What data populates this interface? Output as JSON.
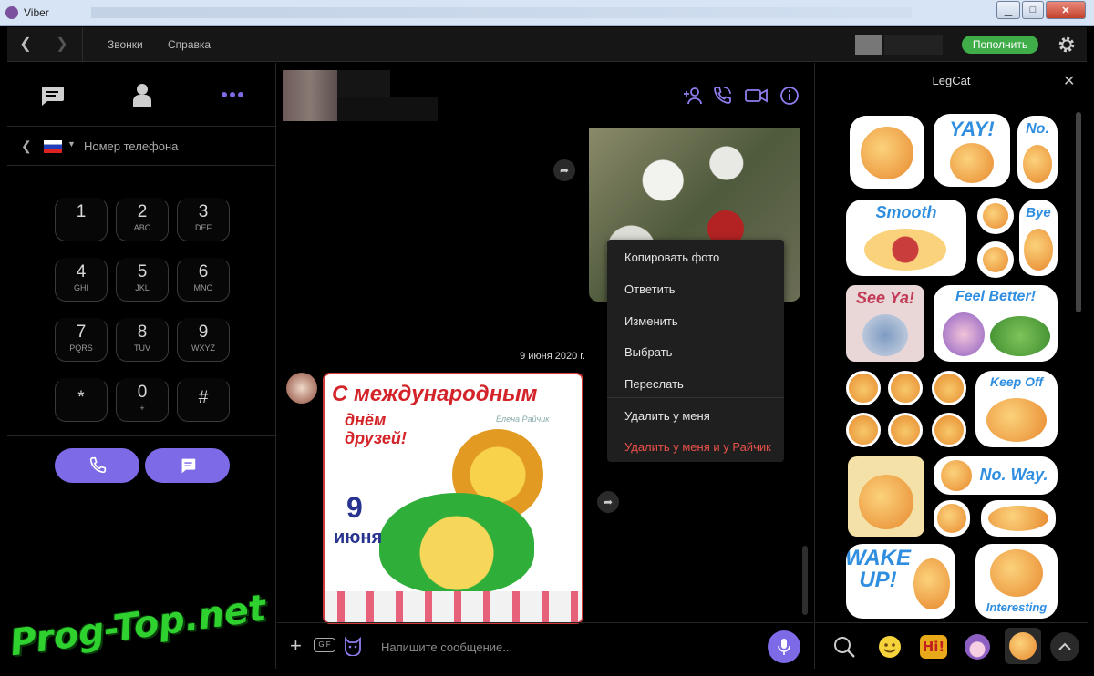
{
  "window": {
    "title": "Viber",
    "buttons": {
      "minimize": "▁",
      "maximize": "□",
      "close": "✕"
    }
  },
  "topnav": {
    "menu": [
      "Звонки",
      "Справка"
    ],
    "topup_label": "Пополнить"
  },
  "left": {
    "tabs": [
      "chats-icon",
      "contacts-icon",
      "more-icon"
    ],
    "phone_label": "Номер телефона",
    "country_flag": "russia-flag-icon",
    "keypad": [
      {
        "digit": "1",
        "letters": ""
      },
      {
        "digit": "2",
        "letters": "ABC"
      },
      {
        "digit": "3",
        "letters": "DEF"
      },
      {
        "digit": "4",
        "letters": "GHI"
      },
      {
        "digit": "5",
        "letters": "JKL"
      },
      {
        "digit": "6",
        "letters": "MNO"
      },
      {
        "digit": "7",
        "letters": "PQRS"
      },
      {
        "digit": "8",
        "letters": "TUV"
      },
      {
        "digit": "9",
        "letters": "WXYZ"
      },
      {
        "digit": "*",
        "letters": ""
      },
      {
        "digit": "0",
        "letters": "+"
      },
      {
        "digit": "#",
        "letters": ""
      }
    ]
  },
  "chat": {
    "date": "9 июня 2020 г.",
    "card_text": {
      "line1": "С международным",
      "line2": "днём друзей!",
      "author": "Елена Райчик",
      "day": "9",
      "month": "июня"
    },
    "context_menu": [
      {
        "label": "Копировать фото",
        "danger": false
      },
      {
        "label": "Ответить",
        "danger": false
      },
      {
        "label": "Изменить",
        "danger": false
      },
      {
        "label": "Выбрать",
        "danger": false
      },
      {
        "label": "Переслать",
        "danger": false
      },
      {
        "label": "Удалить у меня",
        "danger": false
      },
      {
        "label": "Удалить у меня и у Райчик",
        "danger": true
      }
    ],
    "input_placeholder": "Напишите сообщение...",
    "gif_label": "GIF"
  },
  "stickers": {
    "pack_name": "LegCat",
    "sticker_texts": [
      "YAY!",
      "No.",
      "Smooth",
      "Bye",
      "See Ya!",
      "Feel Better!",
      "Keep Off",
      "No. Way.",
      "WAKE UP!",
      "Interesting"
    ],
    "tray": [
      "search-icon",
      "emoji-icon",
      "hi-sticker-icon",
      "girl-sticker-icon",
      "legcat-sticker-icon",
      "chevron-up-icon"
    ]
  },
  "watermark": "Prog-Top.net",
  "colors": {
    "accent": "#7c6ae6",
    "topup": "#3fae49",
    "danger": "#e8514a"
  }
}
